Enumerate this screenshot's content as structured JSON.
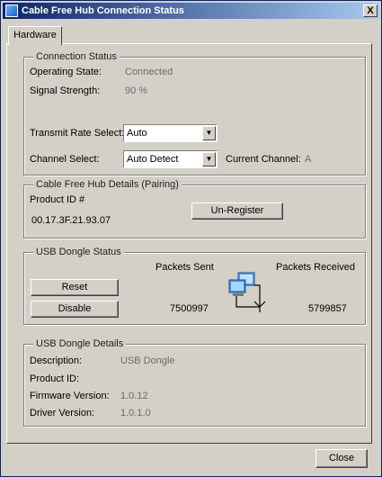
{
  "window": {
    "title": "Cable Free Hub Connection Status",
    "close_glyph": "X"
  },
  "tabs": [
    {
      "label": "Hardware"
    }
  ],
  "connection_status": {
    "legend": "Connection Status",
    "operating_state_label": "Operating State:",
    "operating_state_value": "Connected",
    "signal_strength_label": "Signal Strength:",
    "signal_strength_value": "90 %",
    "transmit_rate_label": "Transmit Rate Select:",
    "transmit_rate_value": "Auto",
    "channel_select_label": "Channel Select:",
    "channel_select_value": "Auto Detect",
    "current_channel_label": "Current Channel:",
    "current_channel_value": "A"
  },
  "hub_details": {
    "legend": "Cable Free Hub Details (Pairing)",
    "product_id_label": "Product ID #",
    "product_id_value": "00.17.3F.21.93.07",
    "unregister_label": "Un-Register"
  },
  "dongle_status": {
    "legend": "USB Dongle Status",
    "reset_label": "Reset",
    "disable_label": "Disable",
    "packets_sent_label": "Packets Sent",
    "packets_sent_value": "7500997",
    "packets_received_label": "Packets Received",
    "packets_received_value": "5799857",
    "network_icon": "network-computer-icon"
  },
  "dongle_details": {
    "legend": "USB Dongle Details",
    "description_label": "Description:",
    "description_value": "USB Dongle",
    "product_id_label": "Product ID:",
    "product_id_value": "",
    "firmware_label": "Firmware Version:",
    "firmware_value": "1.0.12",
    "driver_label": "Driver Version:",
    "driver_value": "1.0.1.0"
  },
  "footer": {
    "close_label": "Close"
  }
}
